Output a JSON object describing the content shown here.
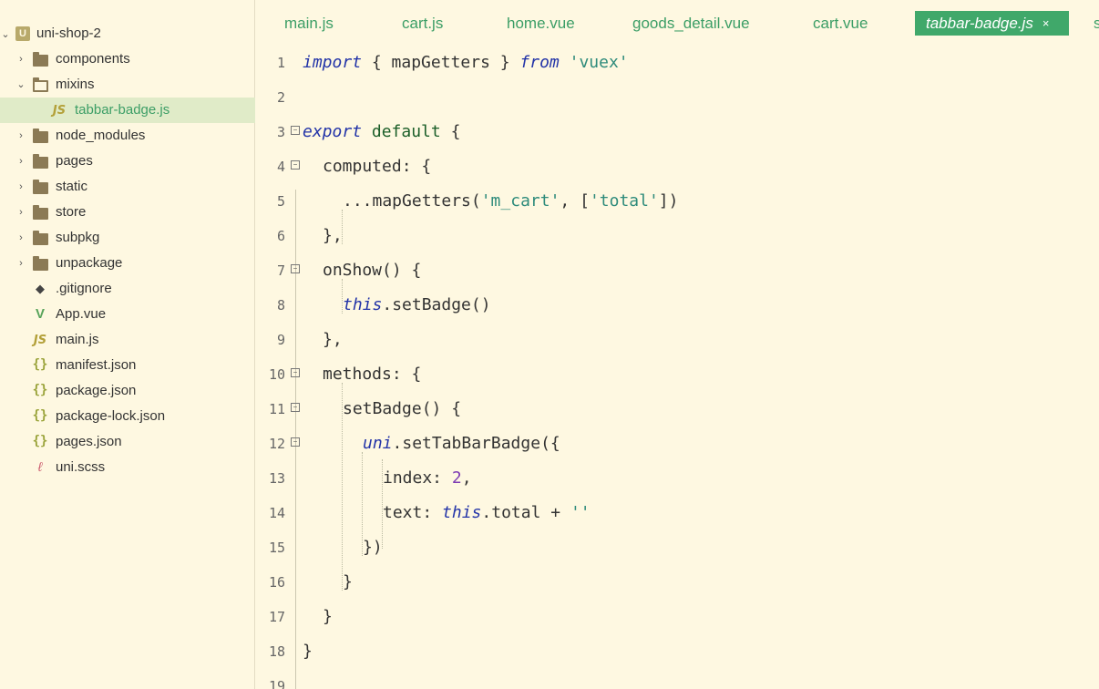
{
  "sidebar": {
    "project": "uni-shop-2",
    "items": [
      {
        "label": "components",
        "type": "folder",
        "expanded": false
      },
      {
        "label": "mixins",
        "type": "folder",
        "expanded": true
      },
      {
        "label": "tabbar-badge.js",
        "type": "js",
        "selected": true
      },
      {
        "label": "node_modules",
        "type": "folder",
        "expanded": false
      },
      {
        "label": "pages",
        "type": "folder",
        "expanded": false
      },
      {
        "label": "static",
        "type": "folder",
        "expanded": false
      },
      {
        "label": "store",
        "type": "folder",
        "expanded": false
      },
      {
        "label": "subpkg",
        "type": "folder",
        "expanded": false
      },
      {
        "label": "unpackage",
        "type": "folder",
        "expanded": false
      },
      {
        "label": ".gitignore",
        "type": "git"
      },
      {
        "label": "App.vue",
        "type": "vue"
      },
      {
        "label": "main.js",
        "type": "js"
      },
      {
        "label": "manifest.json",
        "type": "json"
      },
      {
        "label": "package.json",
        "type": "json"
      },
      {
        "label": "package-lock.json",
        "type": "json"
      },
      {
        "label": "pages.json",
        "type": "json"
      },
      {
        "label": "uni.scss",
        "type": "scss"
      }
    ]
  },
  "tabs": [
    {
      "label": "main.js"
    },
    {
      "label": "cart.js"
    },
    {
      "label": "home.vue"
    },
    {
      "label": "goods_detail.vue"
    },
    {
      "label": "cart.vue"
    },
    {
      "label": "tabbar-badge.js",
      "active": true,
      "close": "×"
    },
    {
      "label": "s"
    }
  ],
  "editor": {
    "line_numbers": [
      "1",
      "2",
      "3",
      "4",
      "5",
      "6",
      "7",
      "8",
      "9",
      "10",
      "11",
      "12",
      "13",
      "14",
      "15",
      "16",
      "17",
      "18",
      "19"
    ],
    "code": {
      "l1": {
        "kw1": "import",
        "t1": " { mapGetters } ",
        "kw2": "from",
        "t2": " ",
        "s1": "'vuex'"
      },
      "l3": {
        "kw1": "export",
        "t1": " ",
        "kw2": "default",
        "t2": " {"
      },
      "l4": {
        "t1": "computed: {"
      },
      "l5": {
        "t1": "...mapGetters(",
        "s1": "'m_cart'",
        "t2": ", [",
        "s2": "'total'",
        "t3": "])"
      },
      "l6": {
        "t1": "},"
      },
      "l7": {
        "t1": "onShow() {"
      },
      "l8": {
        "kw1": "this",
        "t1": ".setBadge()"
      },
      "l9": {
        "t1": "},"
      },
      "l10": {
        "t1": "methods: {"
      },
      "l11": {
        "t1": "setBadge() {"
      },
      "l12": {
        "kw1": "uni",
        "t1": ".setTabBarBadge({"
      },
      "l13": {
        "t1": "index: ",
        "n1": "2",
        "t2": ","
      },
      "l14": {
        "t1": "text: ",
        "kw1": "this",
        "t2": ".total + ",
        "s1": "''"
      },
      "l15": {
        "t1": "})"
      },
      "l16": {
        "t1": "}"
      },
      "l17": {
        "t1": "}"
      },
      "l18": {
        "t1": "}"
      }
    }
  },
  "colors": {
    "background": "#fef8e1",
    "accent": "#40a86a",
    "keyword": "#2334a8",
    "string": "#2e8b7b",
    "number": "#7d3bb3"
  }
}
